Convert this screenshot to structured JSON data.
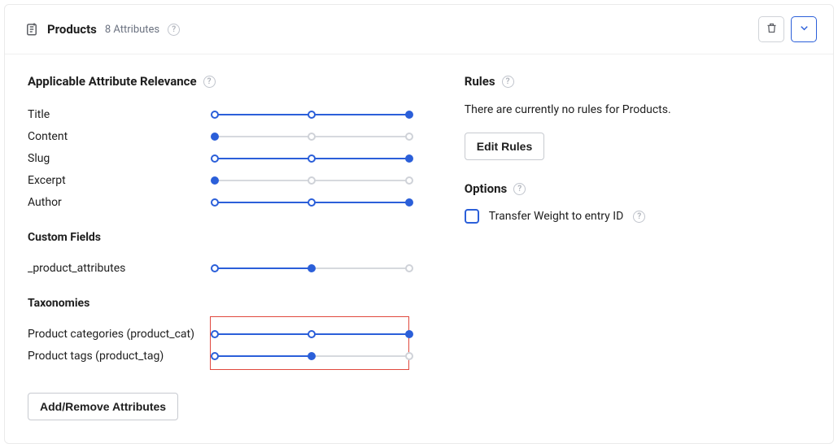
{
  "header": {
    "title": "Products",
    "attr_count_text": "8 Attributes"
  },
  "left": {
    "section_title": "Applicable Attribute Relevance",
    "attributes": [
      {
        "label": "Title",
        "value": 2
      },
      {
        "label": "Content",
        "value": 0
      },
      {
        "label": "Slug",
        "value": 2
      },
      {
        "label": "Excerpt",
        "value": 0
      },
      {
        "label": "Author",
        "value": 2
      }
    ],
    "custom_fields_title": "Custom Fields",
    "custom_fields": [
      {
        "label": "_product_attributes",
        "value": 1
      }
    ],
    "taxonomies_title": "Taxonomies",
    "taxonomies": [
      {
        "label": "Product categories (product_cat)",
        "value": 2
      },
      {
        "label": "Product tags (product_tag)",
        "value": 1
      }
    ],
    "add_remove_btn": "Add/Remove Attributes"
  },
  "right": {
    "rules_title": "Rules",
    "empty_text": "There are currently no rules for Products.",
    "edit_rules_btn": "Edit Rules",
    "options_title": "Options",
    "transfer_weight_label": "Transfer Weight to entry ID"
  },
  "colors": {
    "accent": "#2b5fd9",
    "highlight_border": "#e0483e"
  }
}
